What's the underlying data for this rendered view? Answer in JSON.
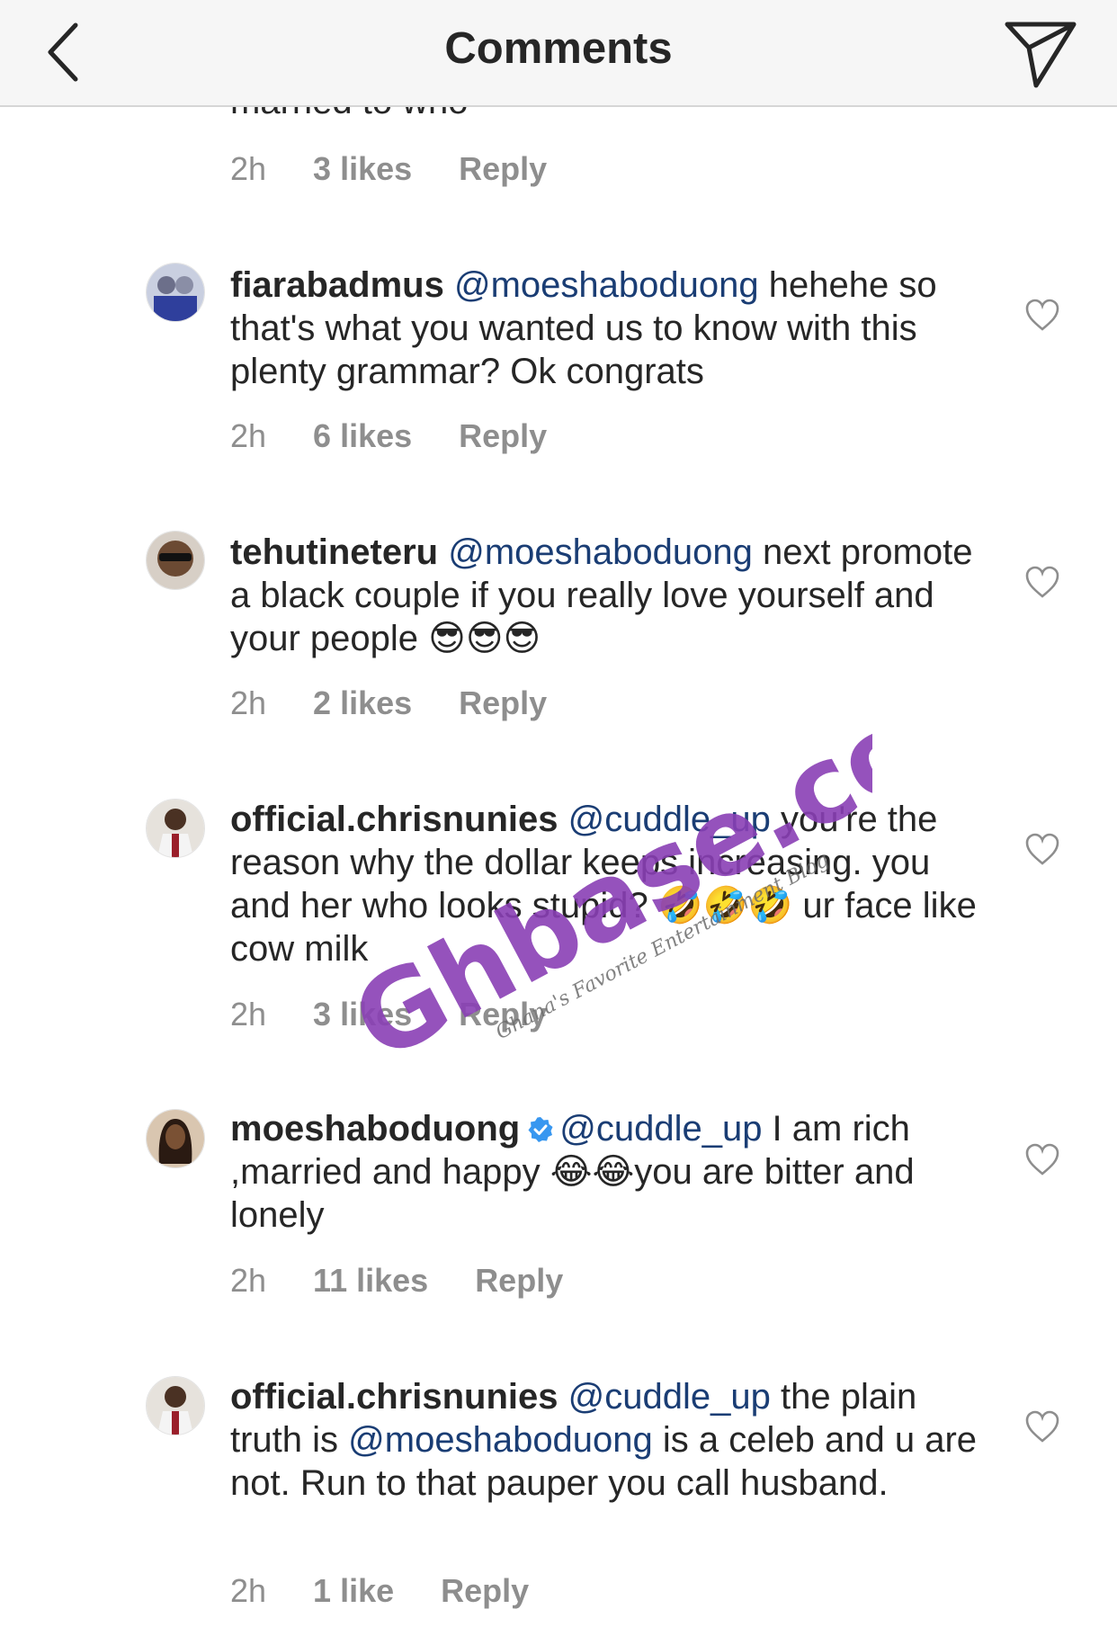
{
  "header": {
    "title": "Comments"
  },
  "partial_comment": {
    "text": "married to who",
    "time": "2h",
    "likes": "3 likes",
    "reply": "Reply"
  },
  "comments": [
    {
      "username": "fiarabadmus",
      "mentions": [
        "@moeshaboduong"
      ],
      "body": [
        " hehehe so that's what you wanted us to know with this plenty grammar? Ok congrats"
      ],
      "time": "2h",
      "likes": "6 likes",
      "reply": "Reply"
    },
    {
      "username": "tehutineteru",
      "mentions": [
        "@moeshaboduong"
      ],
      "body": [
        " next promote a black couple if you really love yourself and your people ",
        "😎😎😎"
      ],
      "time": "2h",
      "likes": "2 likes",
      "reply": "Reply"
    },
    {
      "username": "official.chrisnunies",
      "mentions": [
        "@cuddle_up"
      ],
      "body": [
        " you're the reason why the dollar keeps increasing. you and her who looks stupid? ",
        "🤣🤣🤣",
        " ur face like cow milk"
      ],
      "time": "2h",
      "likes": "3 likes",
      "reply": "Reply"
    },
    {
      "username": "moeshaboduong",
      "verified": true,
      "mentions": [
        "@cuddle_up"
      ],
      "body": [
        "  I am rich ,married and happy ",
        "😂😂",
        "you are bitter and lonely"
      ],
      "time": "2h",
      "likes": "11 likes",
      "reply": "Reply"
    },
    {
      "username": "official.chrisnunies",
      "mentions": [
        "@cuddle_up",
        "@moeshaboduong"
      ],
      "body": [
        "  the plain truth is ",
        " is a celeb and u are not. Run to that pauper you call husband."
      ],
      "time": "2h",
      "likes": "1 like",
      "reply": "Reply"
    }
  ],
  "watermark": {
    "brand": "Ghbase.com",
    "tagline": "Ghana's Favorite Entertainment Blog"
  },
  "colors": {
    "mention": "#1a3d74",
    "meta": "#8e8e8e",
    "text": "#262626",
    "verified": "#3897f0",
    "watermark": "#8a3fb5",
    "watermark_accent": "#e0202a"
  },
  "icons": [
    "back-chevron-icon",
    "send-paper-plane-icon",
    "heart-outline-icon",
    "verified-badge-icon"
  ]
}
